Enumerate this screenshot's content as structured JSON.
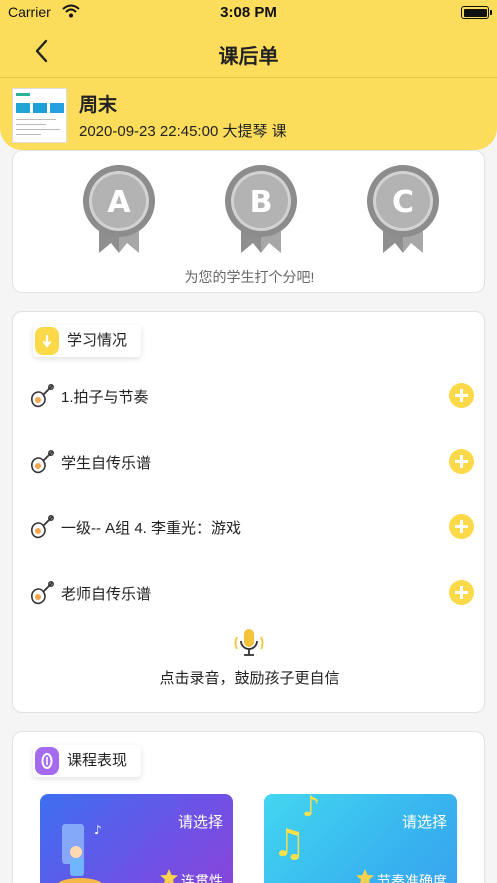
{
  "status_bar": {
    "carrier": "Carrier",
    "time": "3:08 PM"
  },
  "nav": {
    "title": "课后单"
  },
  "course": {
    "name": "周末",
    "meta": "2020-09-23 22:45:00 大提琴  课"
  },
  "grades": {
    "medals": [
      "A",
      "B",
      "C"
    ],
    "hint": "为您的学生打个分吧!"
  },
  "study": {
    "title": "学习情况",
    "items": [
      {
        "label": "1.拍子与节奏"
      },
      {
        "label": "学生自传乐谱"
      },
      {
        "label": "一级-- A组 4. 李重光：游戏"
      },
      {
        "label": "老师自传乐谱"
      }
    ],
    "record_text": "点击录音，鼓励孩子更自信"
  },
  "performance": {
    "title": "课程表现",
    "cards": [
      {
        "select": "请选择",
        "criterion": "连贯性"
      },
      {
        "select": "请选择",
        "criterion": "节奏准确度"
      }
    ]
  },
  "colors": {
    "header": "#fbdc5b",
    "accent": "#fbd949",
    "card_left": "#6b53e6",
    "card_right": "#38b5ef"
  }
}
